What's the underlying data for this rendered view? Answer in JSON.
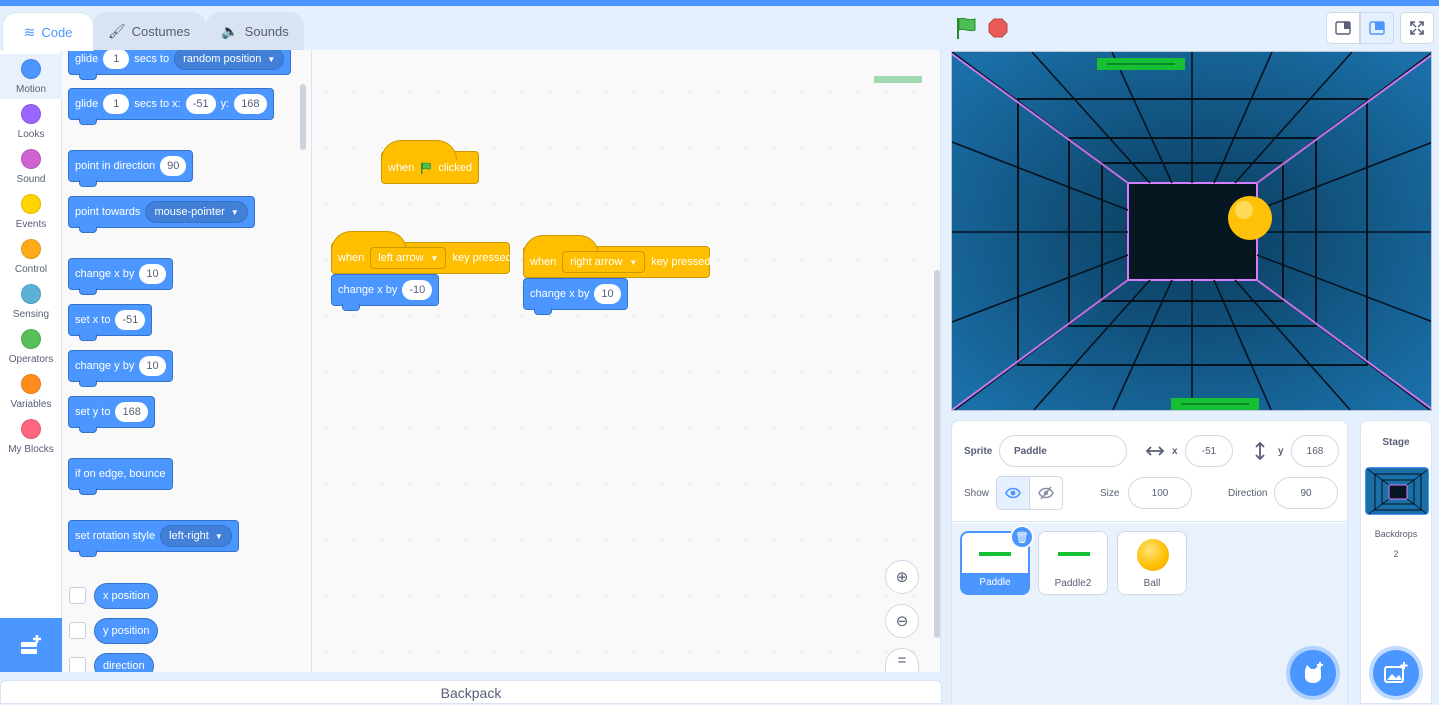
{
  "tabs": {
    "code": "Code",
    "costumes": "Costumes",
    "sounds": "Sounds"
  },
  "categories": [
    {
      "label": "Motion",
      "color": "#4c97ff"
    },
    {
      "label": "Looks",
      "color": "#9966ff"
    },
    {
      "label": "Sound",
      "color": "#cf63cf"
    },
    {
      "label": "Events",
      "color": "#ffd500"
    },
    {
      "label": "Control",
      "color": "#ffab19"
    },
    {
      "label": "Sensing",
      "color": "#5cb1d6"
    },
    {
      "label": "Operators",
      "color": "#59c059"
    },
    {
      "label": "Variables",
      "color": "#ff8c1a"
    },
    {
      "label": "My Blocks",
      "color": "#ff6680"
    }
  ],
  "palette": {
    "glide_random": {
      "w1": "glide",
      "secs": "1",
      "w2": "secs to",
      "target": "random position"
    },
    "glide_xy": {
      "w1": "glide",
      "secs": "1",
      "w2": "secs to x:",
      "x": "-51",
      "w3": "y:",
      "y": "168"
    },
    "point_dir": {
      "text": "point in direction",
      "value": "90"
    },
    "point_towards": {
      "text": "point towards",
      "target": "mouse-pointer"
    },
    "change_x": {
      "text": "change x by",
      "value": "10"
    },
    "set_x": {
      "text": "set x to",
      "value": "-51"
    },
    "change_y": {
      "text": "change y by",
      "value": "10"
    },
    "set_y": {
      "text": "set y to",
      "value": "168"
    },
    "bounce": {
      "text": "if on edge, bounce"
    },
    "rotation": {
      "text": "set rotation style",
      "value": "left-right"
    },
    "reporters": [
      "x position",
      "y position",
      "direction"
    ]
  },
  "script": {
    "flag_hat": {
      "w1": "when",
      "w2": "clicked"
    },
    "left_hat": {
      "w1": "when",
      "key": "left arrow",
      "w2": "key pressed"
    },
    "left_block": {
      "text": "change x by",
      "value": "-10"
    },
    "right_hat": {
      "w1": "when",
      "key": "right arrow",
      "w2": "key pressed"
    },
    "right_block": {
      "text": "change x by",
      "value": "10"
    }
  },
  "backpack": "Backpack",
  "sprite_info": {
    "sprite_label": "Sprite",
    "sprite_name": "Paddle",
    "x_label": "x",
    "x": "-51",
    "y_label": "y",
    "y": "168",
    "show_label": "Show",
    "size_label": "Size",
    "size": "100",
    "direction_label": "Direction",
    "direction": "90"
  },
  "sprites": [
    {
      "name": "Paddle",
      "selected": true
    },
    {
      "name": "Paddle2",
      "selected": false
    },
    {
      "name": "Ball",
      "selected": false
    }
  ],
  "stage_panel": {
    "title": "Stage",
    "backdrops_label": "Backdrops",
    "backdrops_count": "2"
  },
  "colors": {
    "accent": "#4c97ff",
    "events": "#ffbf00",
    "paddle": "#0fb63a",
    "ball": "#ffc107"
  }
}
